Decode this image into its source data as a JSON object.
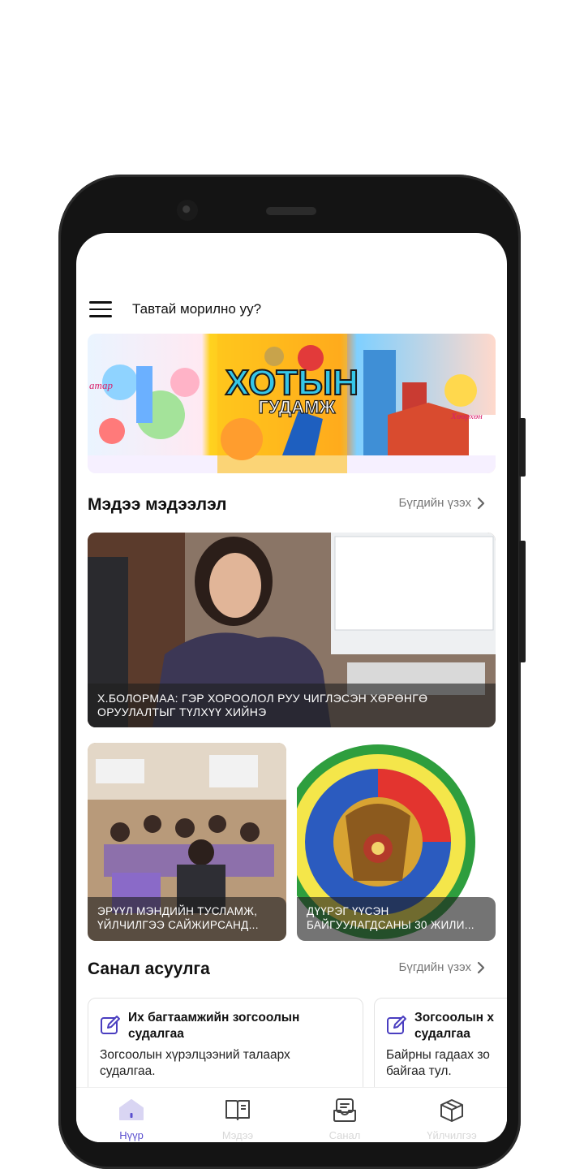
{
  "header": {
    "welcome": "Тавтай морилно уу?"
  },
  "banner": {
    "title_line1": "ХОТЫН",
    "title_line2": "ГУДАМЖ",
    "side_text_left": "атар",
    "side_text_right": "Хөөрхөн"
  },
  "news": {
    "title": "Мэдээ мэдээлэл",
    "see_all": "Бүгдийн үзэх",
    "items": [
      {
        "caption_line1": "Х.БОЛОРМАА: ГЭР ХОРООЛОЛ РУУ ЧИГЛЭСЭН ХӨРӨНГӨ",
        "caption_line2": "ОРУУЛАЛТЫГ ТҮЛХҮҮ ХИЙНЭ"
      },
      {
        "caption_line1": "ЭРҮҮЛ МЭНДИЙН ТУСЛАМЖ,",
        "caption_line2": "ҮЙЛЧИЛГЭЭ САЙЖИРСАНД..."
      },
      {
        "caption_line1": "ДҮҮРЭГ ҮҮСЭН",
        "caption_line2": "БАЙГУУЛАГДСАНЫ 30 ЖИЛИ..."
      }
    ]
  },
  "polls": {
    "title": "Санал асуулга",
    "see_all": "Бүгдийн үзэх",
    "items": [
      {
        "title_line1": "Их багтаамжийн зогсоолын",
        "title_line2": "судалгаа",
        "desc_line1": "Зогсоолын хүрэлцээний талаарх",
        "desc_line2": "судалгаа."
      },
      {
        "title_line1": "Зогсоолын х",
        "title_line2": "судалгаа",
        "desc_line1": "Байрны гадаах зо",
        "desc_line2": "байгаа тул."
      }
    ]
  },
  "nav": {
    "items": [
      {
        "label": "Нүүр",
        "icon": "home-icon",
        "active": true
      },
      {
        "label": "Мэдээ",
        "icon": "book-icon",
        "active": false
      },
      {
        "label": "Санал",
        "icon": "inbox-icon",
        "active": false
      },
      {
        "label": "Үйлчилгээ",
        "icon": "box-icon",
        "active": false
      }
    ]
  },
  "colors": {
    "accent": "#5a4fcf",
    "nav_active_bg": "#d9d5f3"
  }
}
